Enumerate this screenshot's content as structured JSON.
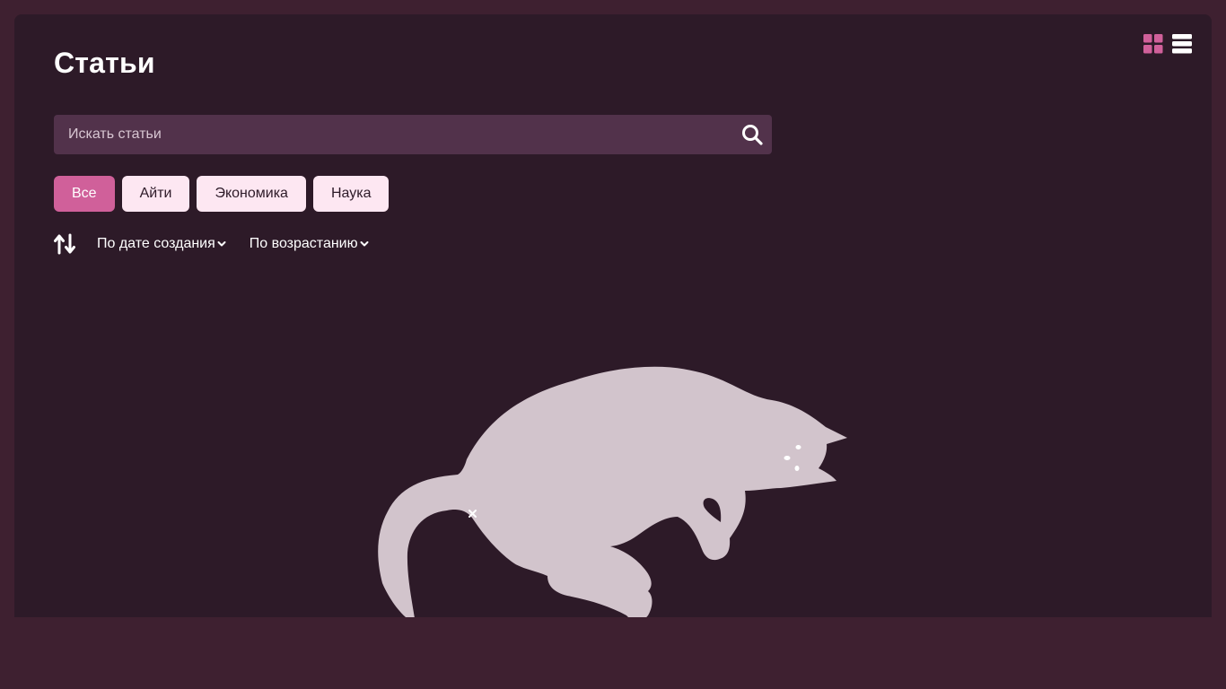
{
  "page": {
    "title": "Статьи"
  },
  "search": {
    "placeholder": "Искать статьи",
    "value": ""
  },
  "filters": {
    "tags": [
      {
        "label": "Все",
        "active": true
      },
      {
        "label": "Айти",
        "active": false
      },
      {
        "label": "Экономика",
        "active": false
      },
      {
        "label": "Наука",
        "active": false
      }
    ]
  },
  "sort": {
    "field_label": "По дате создания",
    "order_label": "По возрастанию"
  },
  "view": {
    "modes": [
      "grid",
      "list"
    ],
    "active": "grid"
  },
  "icons": {
    "view_grid": "grid-view-icon",
    "view_list": "list-view-icon",
    "search": "search-icon",
    "sort": "sort-arrows-icon",
    "dropdown": "chevron-down-icon",
    "empty_state": "cat-illustration"
  },
  "colors": {
    "page_bg": "#3e2030",
    "panel_bg": "#2d1a28",
    "accent": "#d0609a",
    "tag_bg": "#fde7f2",
    "search_bg": "#52324b",
    "illustration": "#d2c4cc"
  }
}
